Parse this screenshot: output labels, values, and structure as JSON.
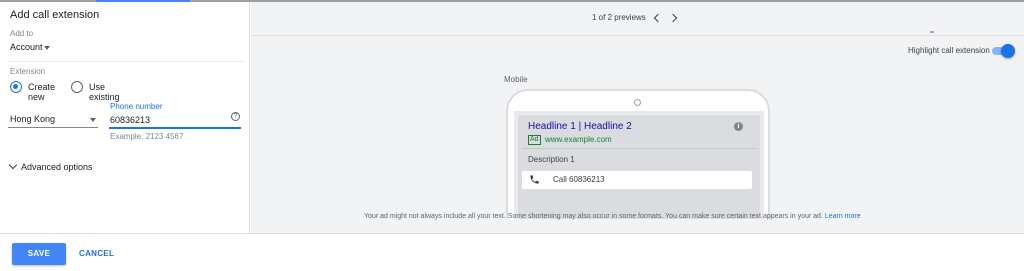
{
  "panel": {
    "title": "Add call extension",
    "add_to_label": "Add to",
    "add_to_value": "Account",
    "extension_label": "Extension",
    "radio_create_new": "Create new",
    "radio_use_existing": "Use existing",
    "selected_option": "Create new",
    "country_value": "Hong Kong",
    "phone_label": "Phone number",
    "phone_value": "60836213",
    "phone_example": "Example: 2123 4567",
    "help_glyph": "?",
    "advanced_options": "Advanced options"
  },
  "preview": {
    "pager_text": "1 of 2 previews",
    "highlight_label": "Highlight call extension",
    "highlight_on": true,
    "device_label": "Mobile",
    "ad": {
      "headline": "Headline 1 | Headline 2",
      "badge": "Ad",
      "url": "www.example.com",
      "description": "Description 1",
      "call_text": "Call 60836213",
      "info_glyph": "i"
    },
    "disclaimer": "Your ad might not always include all your text. Some shortening may also occur in some formats. You can make sure certain text appears in your ad.",
    "learn_more": "Learn more"
  },
  "footer": {
    "save_label": "SAVE",
    "cancel_label": "CANCEL"
  },
  "colors": {
    "accent": "#1a73e8",
    "save_button": "#4285f4",
    "headline": "#1a0dab",
    "url": "#188038"
  },
  "icons": [
    "caret-down-icon",
    "help-icon",
    "chevron-down-icon",
    "chevron-left-icon",
    "chevron-right-icon",
    "info-icon",
    "phone-icon",
    "camera-icon"
  ]
}
